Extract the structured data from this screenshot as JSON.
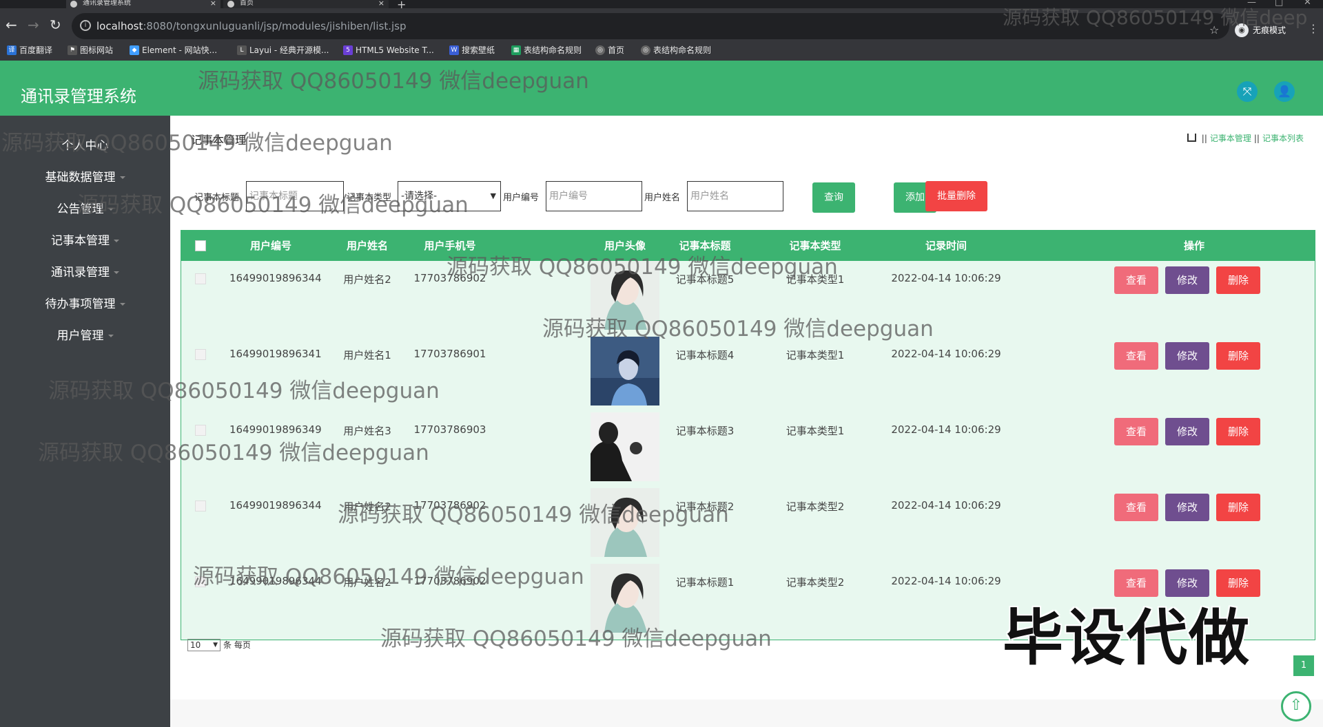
{
  "browser": {
    "tabs": [
      {
        "label": "通讯录管理系统",
        "active": true
      },
      {
        "label": "首页",
        "active": false
      }
    ],
    "url_host": "localhost",
    "url_rest": ":8080/tongxunluguanli/jsp/modules/jishiben/list.jsp",
    "incognito_label": "无痕模式",
    "bookmarks": [
      "百度翻译",
      "图标网站",
      "Element - 网站快...",
      "Layui - 经典开源模...",
      "HTML5 Website T...",
      "搜索壁纸",
      "表结构命名规则",
      "首页",
      "表结构命名规则"
    ]
  },
  "app": {
    "title": "通讯录管理系统"
  },
  "sidebar": {
    "items": [
      {
        "label": "个人中心"
      },
      {
        "label": "基础数据管理"
      },
      {
        "label": "公告管理"
      },
      {
        "label": "记事本管理"
      },
      {
        "label": "通讯录管理"
      },
      {
        "label": "待办事项管理"
      },
      {
        "label": "用户管理"
      }
    ]
  },
  "page": {
    "heading": "记事本管理",
    "breadcrumb": [
      "记事本管理",
      "记事本列表"
    ]
  },
  "filters": {
    "title_label": "记事本标题",
    "title_placeholder": "记事本标题",
    "type_label": "记事本类型",
    "type_value": "-请选择-",
    "user_no_label": "用户编号",
    "user_no_placeholder": "用户编号",
    "user_name_label": "用户姓名",
    "user_name_placeholder": "用户姓名",
    "query_button": "查询",
    "add_button": "添加",
    "batch_delete_button": "批量删除"
  },
  "table": {
    "headers": [
      "用户编号",
      "用户姓名",
      "用户手机号",
      "用户头像",
      "记事本标题",
      "记事本类型",
      "记录时间",
      "操作"
    ],
    "rows": [
      {
        "user_no": "16499019896344",
        "user_name": "用户姓名2",
        "phone": "17703786902",
        "title": "记事本标题5",
        "type": "记事本类型1",
        "time": "2022-04-14 10:06:29",
        "avatar": "woman-teal"
      },
      {
        "user_no": "16499019896341",
        "user_name": "用户姓名1",
        "phone": "17703786901",
        "title": "记事本标题4",
        "type": "记事本类型1",
        "time": "2022-04-14 10:06:29",
        "avatar": "man-blue"
      },
      {
        "user_no": "16499019896349",
        "user_name": "用户姓名3",
        "phone": "17703786903",
        "title": "记事本标题3",
        "type": "记事本类型1",
        "time": "2022-04-14 10:06:29",
        "avatar": "man-silhouette"
      },
      {
        "user_no": "16499019896344",
        "user_name": "用户姓名2",
        "phone": "17703786902",
        "title": "记事本标题2",
        "type": "记事本类型2",
        "time": "2022-04-14 10:06:29",
        "avatar": "woman-teal"
      },
      {
        "user_no": "16499019896344",
        "user_name": "用户姓名2",
        "phone": "17703786902",
        "title": "记事本标题1",
        "type": "记事本类型2",
        "time": "2022-04-14 10:06:29",
        "avatar": "woman-teal"
      }
    ],
    "actions": {
      "view": "查看",
      "edit": "修改",
      "delete": "删除"
    }
  },
  "pager": {
    "page_size": "10",
    "page_size_suffix": "条 每页",
    "current_page": "1"
  },
  "watermarks": {
    "text": "源码获取 QQ86050149 微信deepguan",
    "corner_text": "源码获取 QQ86050149 微信deep",
    "big_text": "毕设代做"
  },
  "colors": {
    "primary": "#3cb371",
    "sidebar": "#3d4145",
    "danger": "#f24444",
    "view": "#f06b7a",
    "edit": "#6f4e8f"
  }
}
